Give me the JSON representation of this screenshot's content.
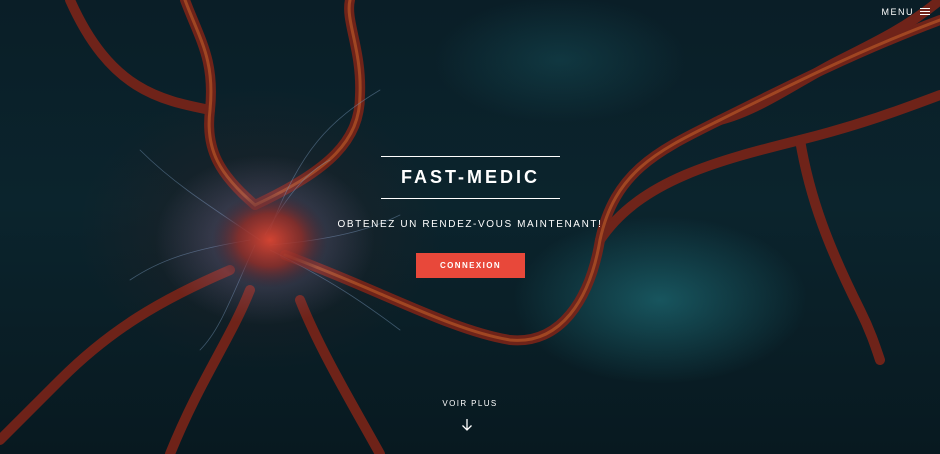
{
  "header": {
    "menu_label": "MENU"
  },
  "hero": {
    "title": "FAST-MEDIC",
    "subtitle": "OBTENEZ UN RENDEZ-VOUS MAINTENANT!",
    "cta_label": "CONNEXION",
    "more_label": "VOIR PLUS"
  },
  "colors": {
    "accent": "#e8483a",
    "background": "#0a1e27",
    "neuron": "#8a2a1c",
    "neuron_core": "#c0392b"
  },
  "icons": {
    "menu": "hamburger-icon",
    "scroll": "arrow-down-icon"
  }
}
